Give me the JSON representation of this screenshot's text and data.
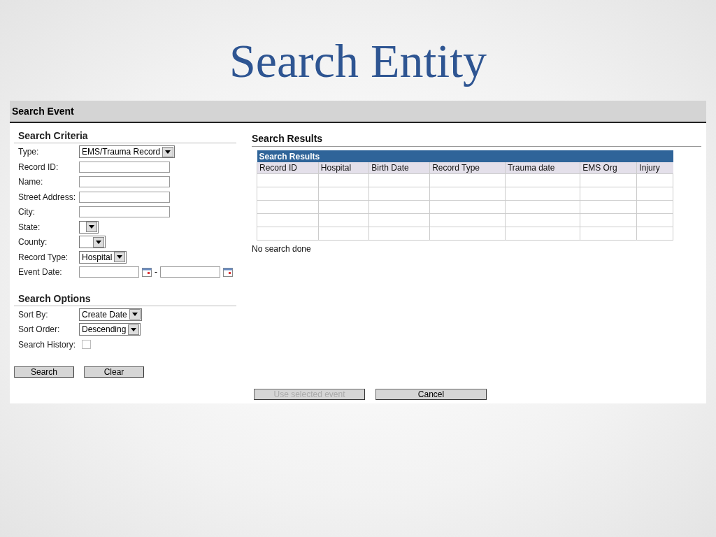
{
  "slide_title": "Search Entity",
  "window": {
    "title": "Search Event"
  },
  "criteria": {
    "heading": "Search Criteria",
    "fields": [
      {
        "kind": "select",
        "label": "Type:",
        "value": "EMS/Trauma Record"
      },
      {
        "kind": "text",
        "label": "Record ID:"
      },
      {
        "kind": "text",
        "label": "Name:"
      },
      {
        "kind": "text",
        "label": "Street Address:"
      },
      {
        "kind": "text",
        "label": "City:"
      },
      {
        "kind": "select",
        "label": "State:"
      },
      {
        "kind": "select",
        "label": "County:"
      },
      {
        "kind": "select",
        "label": "Record Type:",
        "value": "Hospital"
      },
      {
        "kind": "daterange",
        "label": "Event Date:",
        "separator": "-"
      }
    ]
  },
  "options": {
    "heading": "Search Options",
    "fields": [
      {
        "kind": "select",
        "label": "Sort By:",
        "value": "Create Date"
      },
      {
        "kind": "select",
        "label": "Sort Order:",
        "value": "Descending"
      },
      {
        "kind": "checkbox",
        "label": "Search History:",
        "checked": false,
        "disabled": true
      }
    ]
  },
  "form_buttons": [
    {
      "label": "Search",
      "disabled": false
    },
    {
      "label": "Clear",
      "disabled": false
    }
  ],
  "results": {
    "heading": "Search Results",
    "table_title": "Search Results",
    "columns": [
      "Record ID",
      "Hospital",
      "Birth Date",
      "Record Type",
      "Trauma date",
      "EMS Org",
      "Injury"
    ],
    "status": "No search done"
  },
  "dialog_buttons": [
    {
      "label": "Use selected event",
      "disabled": true
    },
    {
      "label": "Cancel",
      "disabled": false
    }
  ]
}
